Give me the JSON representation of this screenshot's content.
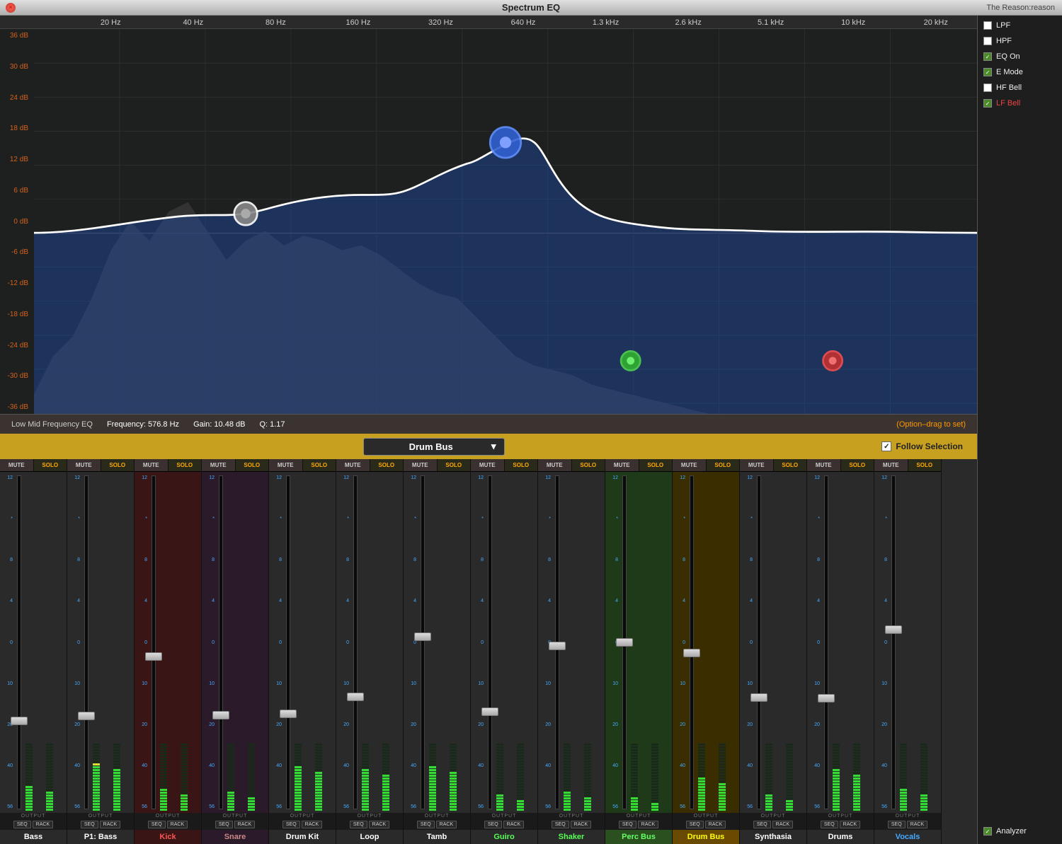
{
  "titleBar": {
    "title": "Spectrum EQ",
    "rightText": "The Reason:reason",
    "closeBtn": "×"
  },
  "freqLabels": [
    "20 Hz",
    "40 Hz",
    "80 Hz",
    "160 Hz",
    "320 Hz",
    "640 Hz",
    "1.3 kHz",
    "2.6 kHz",
    "5.1 kHz",
    "10 kHz",
    "20 kHz"
  ],
  "dbLabels": [
    "36 dB",
    "30 dB",
    "24 dB",
    "18 dB",
    "12 dB",
    "6 dB",
    "0 dB",
    "-6 dB",
    "-12 dB",
    "-18 dB",
    "-24 dB",
    "-30 dB",
    "-36 dB"
  ],
  "checkboxes": [
    {
      "label": "LPF",
      "checked": false
    },
    {
      "label": "HPF",
      "checked": false
    },
    {
      "label": "EQ On",
      "checked": true
    },
    {
      "label": "E Mode",
      "checked": true
    },
    {
      "label": "HF Bell",
      "checked": false
    },
    {
      "label": "LF Bell",
      "checked": true
    },
    {
      "label": "Analyzer",
      "checked": true
    }
  ],
  "statusBar": {
    "label": "Low Mid Frequency EQ",
    "frequency": "Frequency: 576.8 Hz",
    "gain": "Gain: 10.48 dB",
    "q": "Q: 1.17",
    "hint": "(Option–drag to set)"
  },
  "channelSelector": {
    "label": "Drum Bus",
    "followSelection": "Follow Selection",
    "followChecked": true
  },
  "scaleValues": [
    "12",
    "*",
    "8",
    "4",
    "0",
    "10",
    "20",
    "40",
    "56"
  ],
  "channels": [
    {
      "name": "Bass",
      "colorClass": "",
      "nameColor": "#fff",
      "seq": "SEQ",
      "rack": "RACK",
      "highlight": ""
    },
    {
      "name": "P1: Bass",
      "colorClass": "",
      "nameColor": "#fff",
      "seq": "SEQ",
      "rack": "RACK",
      "highlight": ""
    },
    {
      "name": "Kick",
      "colorClass": "ch-kick",
      "nameColor": "#f55",
      "seq": "SEQ",
      "rack": "RACK",
      "highlight": ""
    },
    {
      "name": "Snare",
      "colorClass": "ch-snare",
      "nameColor": "#c88",
      "seq": "SEQ",
      "rack": "RACK",
      "highlight": ""
    },
    {
      "name": "Drum Kit",
      "colorClass": "",
      "nameColor": "#fff",
      "seq": "SEQ",
      "rack": "RACK",
      "highlight": ""
    },
    {
      "name": "Loop",
      "colorClass": "",
      "nameColor": "#fff",
      "seq": "SEQ",
      "rack": "RACK",
      "highlight": ""
    },
    {
      "name": "Tamb",
      "colorClass": "",
      "nameColor": "#fff",
      "seq": "SEQ",
      "rack": "RACK",
      "highlight": ""
    },
    {
      "name": "Guiro",
      "colorClass": "ch-guiro",
      "nameColor": "#5f5",
      "seq": "SEQ",
      "rack": "RACK",
      "highlight": ""
    },
    {
      "name": "Shaker",
      "colorClass": "",
      "nameColor": "#5f5",
      "seq": "SEQ",
      "rack": "RACK",
      "highlight": ""
    },
    {
      "name": "Perc Bus",
      "colorClass": "ch-percbus",
      "nameColor": "#6f6",
      "seq": "SEQ",
      "rack": "RACK",
      "highlight": "green"
    },
    {
      "name": "Drum Bus",
      "colorClass": "ch-drumbus",
      "nameColor": "#ff0",
      "seq": "SEQ",
      "rack": "RACK",
      "highlight": "yellow"
    },
    {
      "name": "Synthasia",
      "colorClass": "",
      "nameColor": "#fff",
      "seq": "SEQ",
      "rack": "RACK",
      "highlight": ""
    },
    {
      "name": "Drums",
      "colorClass": "",
      "nameColor": "#fff",
      "seq": "SEQ",
      "rack": "RACK",
      "highlight": ""
    },
    {
      "name": "Vocals",
      "colorClass": "ch-vocals",
      "nameColor": "#4af",
      "seq": "SEQ",
      "rack": "RACK",
      "highlight": ""
    }
  ]
}
